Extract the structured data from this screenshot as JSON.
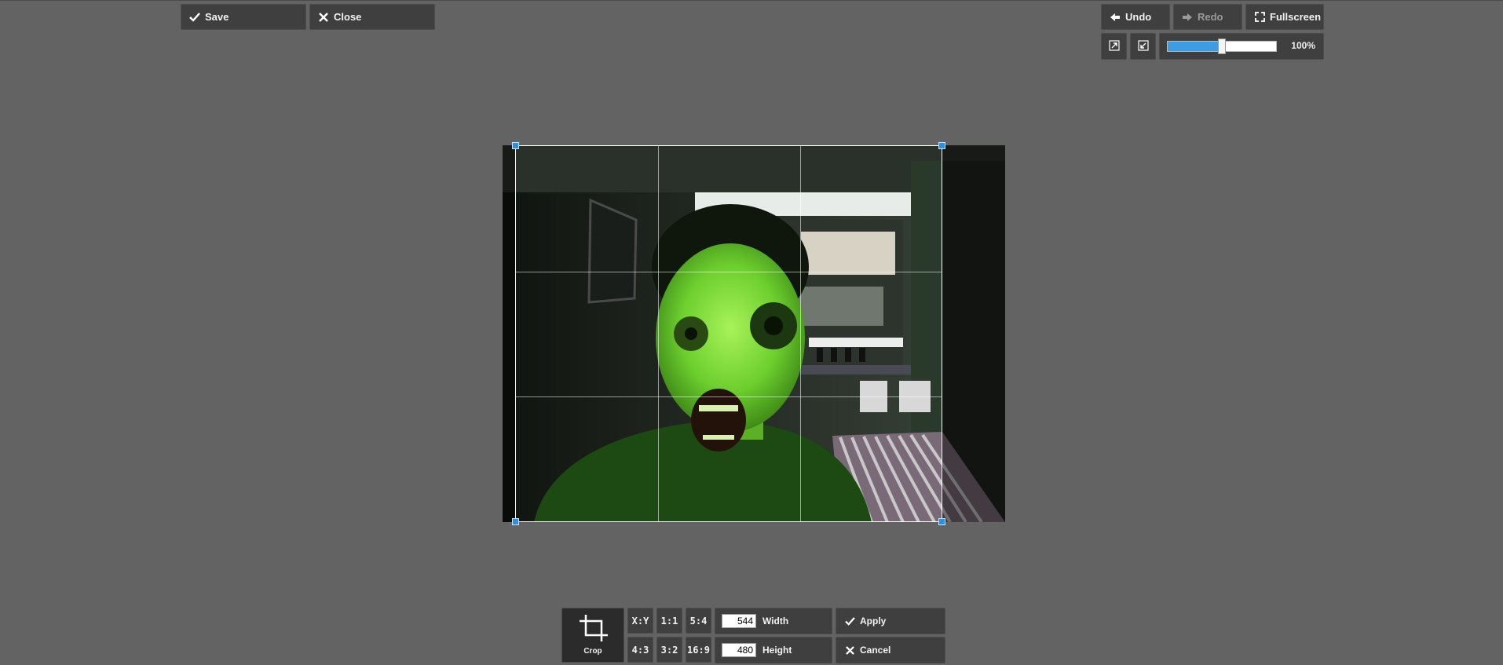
{
  "top_left": {
    "save_label": "Save",
    "close_label": "Close"
  },
  "top_right": {
    "undo_label": "Undo",
    "redo_label": "Redo",
    "fullscreen_label": "Fullscreen",
    "zoom_value": "100%",
    "zoom_slider_fraction": 0.5
  },
  "crop_tool": {
    "label": "Crop",
    "ratios_top": [
      "X:Y",
      "1:1",
      "5:4"
    ],
    "ratios_bottom": [
      "4:3",
      "3:2",
      "16:9"
    ],
    "width_value": "544",
    "width_label": "Width",
    "height_value": "480",
    "height_label": "Height",
    "apply_label": "Apply",
    "cancel_label": "Cancel"
  },
  "colors": {
    "background": "#636363",
    "button": "#3f3f3f",
    "accent": "#3a9ee6",
    "handle": "#2d8fe0"
  },
  "icons": {
    "save": "checkmark-icon",
    "close": "close-icon",
    "undo": "arrow-left-icon",
    "redo": "arrow-right-icon",
    "fullscreen": "fullscreen-icon",
    "zoom_fit": "zoom-fit-icon",
    "zoom_actual": "zoom-actual-icon",
    "crop": "crop-icon"
  }
}
